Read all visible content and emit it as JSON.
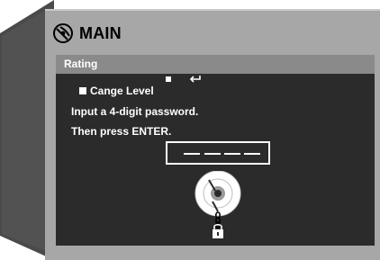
{
  "window": {
    "title": "MAIN"
  },
  "panel": {
    "header": "Rating",
    "menu_item": "Cange Level",
    "instruction_1": "Input a 4-digit password.",
    "instruction_2": "Then press ENTER.",
    "password_placeholder": "____",
    "password_value": ""
  },
  "icons": {
    "title_icon": "satellite-disc-icon",
    "bullet": "square-bullet",
    "return": "return-arrow-icon",
    "disc_lock": "disc-with-padlock-icon"
  },
  "colors": {
    "box_frame": "#a7a7a7",
    "screen_background": "#2b2b2b",
    "header_bar": "#8a8a8a",
    "text": "#ffffff"
  }
}
